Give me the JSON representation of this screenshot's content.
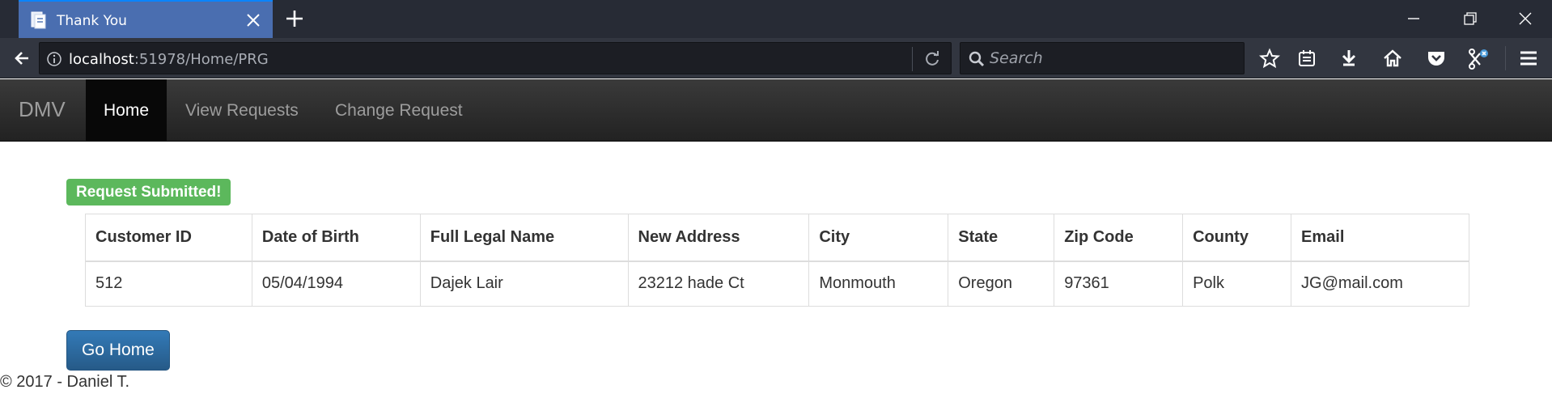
{
  "browser": {
    "tab_title": "Thank You",
    "url_host": "localhost",
    "url_rest": ":51978/Home/PRG",
    "search_placeholder": "Search"
  },
  "site": {
    "brand": "DMV",
    "nav": [
      {
        "label": "Home",
        "active": true
      },
      {
        "label": "View Requests",
        "active": false
      },
      {
        "label": "Change Request",
        "active": false
      }
    ]
  },
  "status_badge": "Request Submitted!",
  "table": {
    "headers": [
      "Customer ID",
      "Date of Birth",
      "Full Legal Name",
      "New Address",
      "City",
      "State",
      "Zip Code",
      "County",
      "Email"
    ],
    "rows": [
      [
        "512",
        "05/04/1994",
        "Dajek Lair",
        "23212 hade Ct",
        "Monmouth",
        "Oregon",
        "97361",
        "Polk",
        "JG@mail.com"
      ]
    ]
  },
  "go_home_label": "Go Home",
  "footer": "© 2017 - Daniel T.",
  "colors": {
    "success": "#5cb85c",
    "primary_button": "#337ab7",
    "active_tab": "#4a6eb0"
  },
  "icons": [
    "page-icon",
    "close-icon",
    "plus-icon",
    "minimize-icon",
    "restore-icon",
    "window-close-icon",
    "back-arrow-icon",
    "info-icon",
    "reload-icon",
    "search-icon",
    "star-icon",
    "reading-list-icon",
    "download-icon",
    "home-icon",
    "pocket-icon",
    "extension-icon",
    "menu-icon"
  ]
}
